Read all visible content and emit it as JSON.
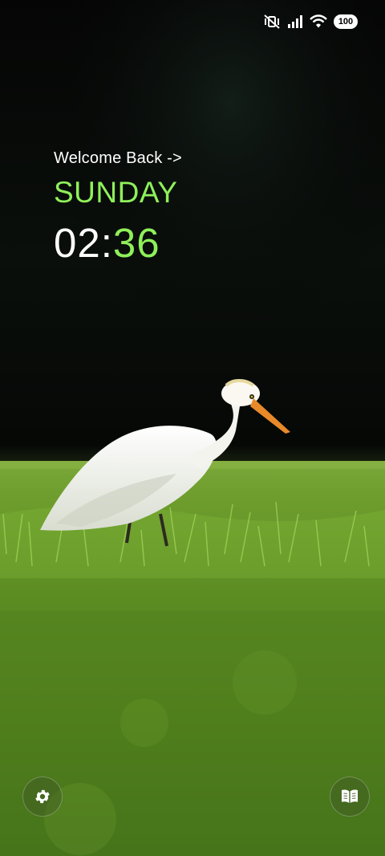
{
  "status_bar": {
    "icons": [
      "vibrate-mute-icon",
      "cellular-signal-icon",
      "wifi-icon"
    ],
    "battery_level": "100"
  },
  "lock_widget": {
    "greeting": "Welcome Back ->",
    "day": "SUNDAY",
    "hours": "02",
    "separator": ":",
    "minutes": "36",
    "accent_color": "#8ff05a"
  },
  "shortcuts": {
    "left_icon": "settings-gear-icon",
    "right_icon": "open-book-icon"
  },
  "wallpaper": {
    "subject": "white egret in green grass"
  }
}
